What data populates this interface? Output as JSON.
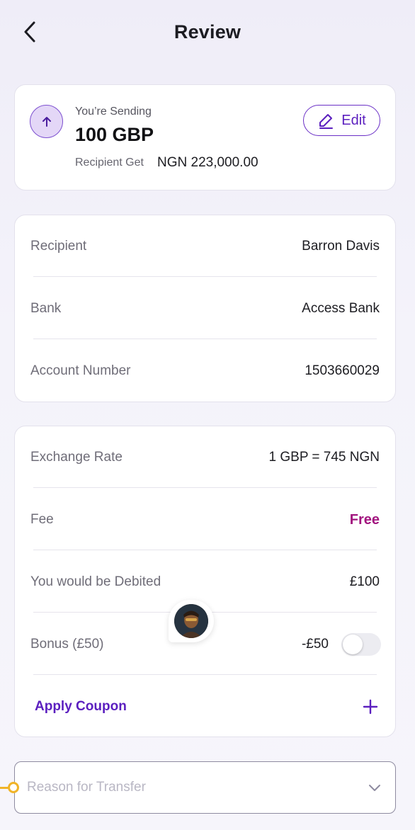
{
  "header": {
    "title": "Review"
  },
  "sending": {
    "label": "You’re Sending",
    "amount": "100 GBP",
    "recipient_get_label": "Recipient Get",
    "recipient_get_value": "NGN 223,000.00",
    "edit_label": "Edit"
  },
  "details": {
    "rows": [
      {
        "label": "Recipient",
        "value": "Barron Davis"
      },
      {
        "label": "Bank",
        "value": "Access Bank"
      },
      {
        "label": "Account Number",
        "value": "1503660029"
      }
    ]
  },
  "payment": {
    "exchange_rate_label": "Exchange Rate",
    "exchange_rate_value": "1 GBP = 745 NGN",
    "fee_label": "Fee",
    "fee_value": "Free",
    "debited_label": "You would be Debited",
    "debited_value": "£100",
    "bonus_label": "Bonus (£50)",
    "bonus_value": "-£50",
    "bonus_enabled": false,
    "apply_coupon_label": "Apply Coupon"
  },
  "reason": {
    "placeholder": "Reason for Transfer"
  },
  "colors": {
    "accent": "#5b1fbf",
    "fee_free": "#a2157f",
    "connector": "#f0b429"
  }
}
